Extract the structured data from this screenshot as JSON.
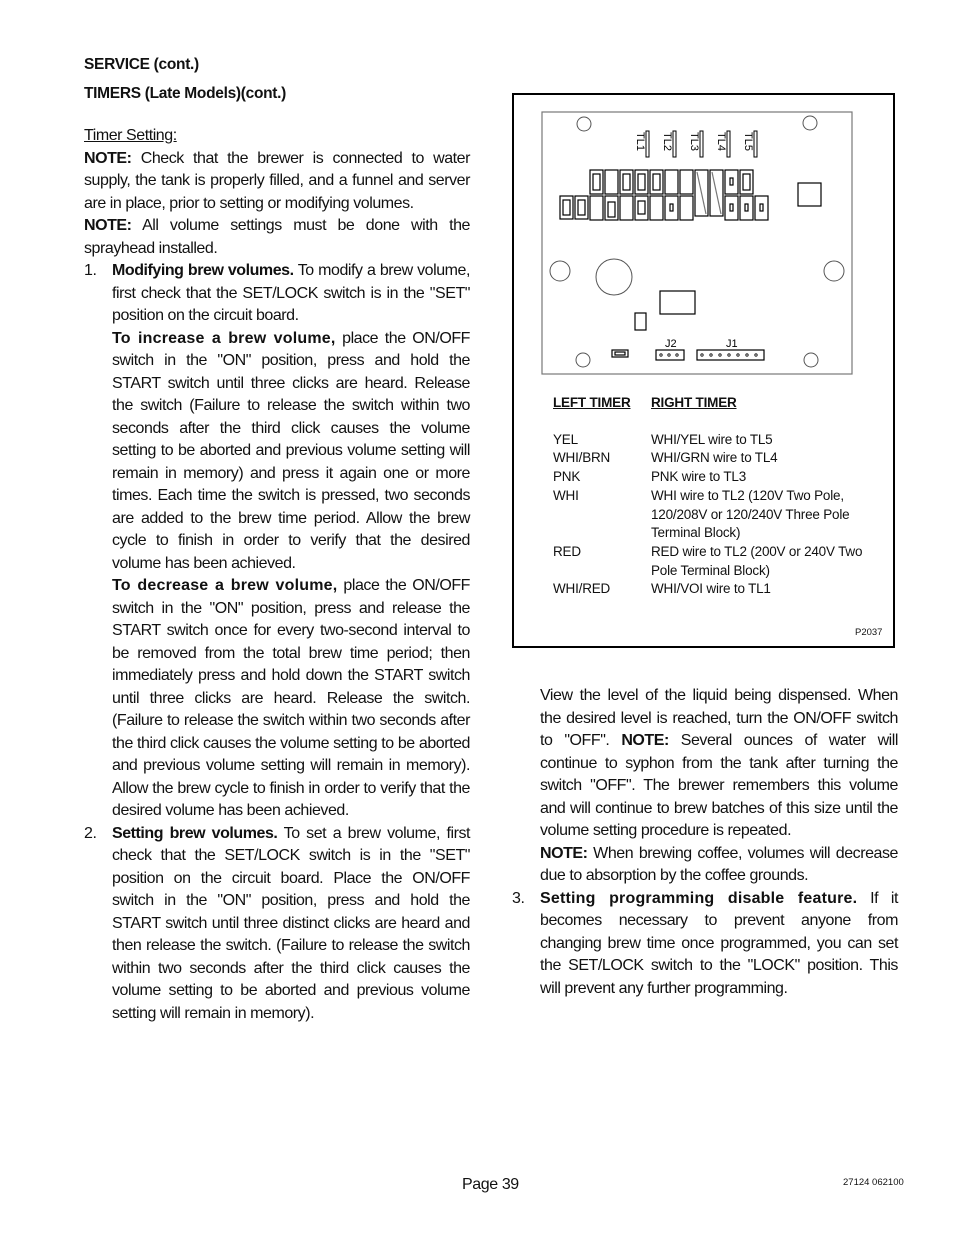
{
  "header": {
    "section": "SERVICE (cont.)",
    "subsection": "TIMERS (Late Models)(cont.)"
  },
  "left_column": {
    "subheading": "Timer Setting:",
    "note1_label": "NOTE:",
    "note1_text": " Check that the brewer is connected to water supply, the tank is properly filled, and a funnel and server are in place, prior to setting or modifying volumes.",
    "note2_label": "NOTE:",
    "note2_text": " All volume settings must be done with the sprayhead installed.",
    "item1": {
      "number": "1.",
      "title": "Modifying brew volumes.",
      "text": " To modify a brew volume, first check that the SET/LOCK switch is in the \"SET\" position on the circuit board.",
      "increase_title": "To increase a brew volume,",
      "increase_text": " place the ON/OFF switch in the \"ON\" position, press and hold the START switch until three clicks are heard. Release the switch (Failure to release the switch within two seconds after the third click causes the volume setting to be aborted and previous volume setting will remain in memory) and press it again one or more times. Each time the switch is pressed, two seconds are added to the brew time period.  Allow the brew cycle to finish in order to verify that the desired volume has been achieved.",
      "decrease_title": "To decrease a brew volume,",
      "decrease_text": " place the ON/OFF switch in the \"ON\" position, press and release the START switch once for every two-second interval to be removed from the total brew time period; then immediately press and hold down the START switch until three clicks are heard. Release the switch. (Failure to release the switch within two seconds after the third click causes the volume setting to be aborted and previous volume setting will remain in memory). Allow the brew cycle to finish in order to verify that the desired volume has been achieved."
    },
    "item2": {
      "number": "2.",
      "title": "Setting brew volumes.",
      "text": " To set a brew volume, first check that the SET/LOCK switch is in the \"SET\" position on the circuit board. Place the ON/OFF switch in the \"ON\" position, press and hold the START switch until three distinct clicks are heard and then release the switch. (Failure to release the switch within two seconds after the third click causes the volume setting to be aborted and previous volume setting will remain in memory)."
    }
  },
  "right_column": {
    "continuation_a": "View the level of the liquid being dispensed. When the desired level is reached, turn the ON/OFF switch to \"OFF\". ",
    "continuation_note_label": "NOTE:",
    "continuation_b": " Several ounces of water will continue to syphon from the tank after turning the switch \"OFF\". The brewer remembers this volume and will continue to brew batches of this size until the volume setting procedure is repeated.",
    "note_label": "NOTE:",
    "note_text": " When brewing coffee, volumes will decrease due to absorption by the coffee grounds.",
    "item3": {
      "number": "3.",
      "title": "Setting programming disable feature.",
      "text": " If it becomes necessary to prevent anyone from changing brew time once programmed, you can set the SET/LOCK switch to the \"LOCK\" position. This will prevent any further programming."
    }
  },
  "figure": {
    "board_labels": {
      "terminals": [
        "TL1",
        "TL2",
        "TL3",
        "TL4",
        "TL5"
      ],
      "j2": "J2",
      "j1": "J1"
    },
    "legend": {
      "left_header": "LEFT TIMER",
      "right_header": "RIGHT TIMER",
      "rows": [
        {
          "left": "YEL",
          "right": "WHI/YEL wire to TL5"
        },
        {
          "left": "WHI/BRN",
          "right": "WHI/GRN wire to TL4"
        },
        {
          "left": "PNK",
          "right": "PNK wire to TL3"
        },
        {
          "left": "WHI",
          "right": "WHI wire to TL2 (120V Two Pole, 120/208V or 120/240V Three Pole Terminal Block)"
        },
        {
          "left": "RED",
          "right": "RED wire to TL2 (200V or 240V Two Pole Terminal Block)"
        },
        {
          "left": "WHI/RED",
          "right": "WHI/VOI wire to TL1"
        }
      ]
    },
    "figure_id": "P2037"
  },
  "footer": {
    "page": "Page 39",
    "doc_code": "27124 062100"
  }
}
